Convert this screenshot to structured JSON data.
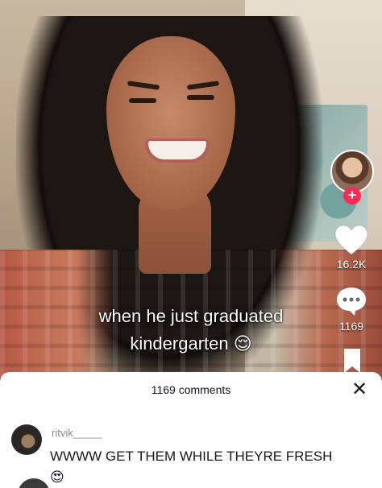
{
  "video": {
    "caption_line1": "when he just graduated",
    "caption_line2": "kindergarten 😌"
  },
  "actions": {
    "likes_count": "16.2K",
    "comments_count": "1169",
    "follow_symbol": "+"
  },
  "comments_sheet": {
    "header": "1169 comments",
    "close_symbol": "✕",
    "comments": [
      {
        "username": "ritvik_____",
        "text": "WWWW GET THEM WHILE THEYRE FRESH 😍"
      }
    ]
  },
  "colors": {
    "follow_accent": "#fe2c55",
    "sheet_bg": "#ffffff",
    "text_primary": "#161823",
    "text_secondary": "#8a8b91"
  },
  "icons": {
    "like": "heart-icon",
    "comment": "comment-bubble-icon",
    "save": "bookmark-icon",
    "close": "close-icon"
  }
}
